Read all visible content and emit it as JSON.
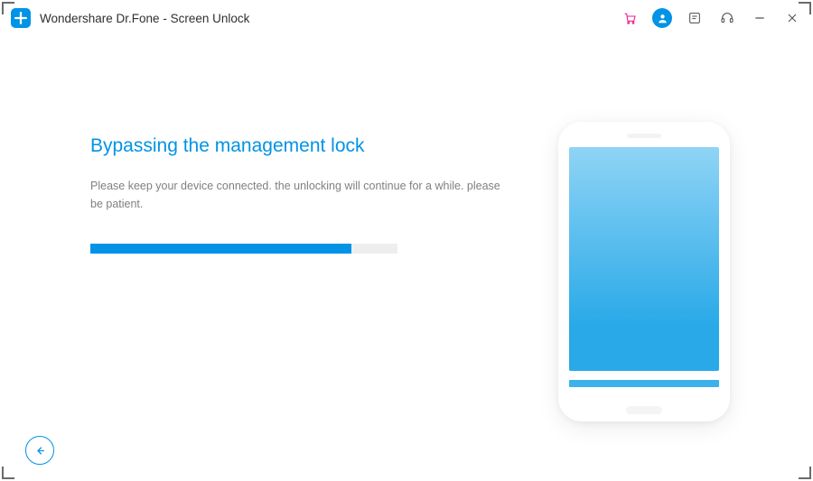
{
  "app": {
    "title": "Wondershare Dr.Fone - Screen Unlock"
  },
  "titlebar_icons": {
    "cart": "cart-icon",
    "user": "user-icon",
    "feedback": "feedback-icon",
    "support": "support-icon",
    "minimize": "minimize-icon",
    "close": "close-icon"
  },
  "main": {
    "heading": "Bypassing the management lock",
    "subtext": "Please keep your device connected. the unlocking will continue for a while. please be patient."
  },
  "progress": {
    "percent": 85
  },
  "colors": {
    "accent": "#0093e6",
    "text_muted": "#808080",
    "cart_stroke": "#e91e8c"
  }
}
